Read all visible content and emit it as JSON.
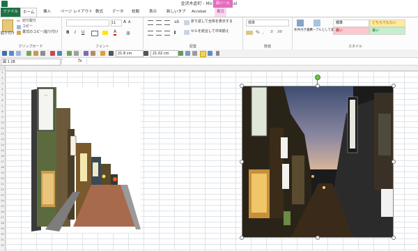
{
  "window": {
    "title": "金沢木倉町 - Microsoft Excel",
    "contextual_tab_group": "図ツール"
  },
  "tabs": [
    {
      "label": "ファイル"
    },
    {
      "label": "ホーム"
    },
    {
      "label": "挿入"
    },
    {
      "label": "ページ レイアウト"
    },
    {
      "label": "数式"
    },
    {
      "label": "データ"
    },
    {
      "label": "校閲"
    },
    {
      "label": "表示"
    },
    {
      "label": "新しいタブ"
    },
    {
      "label": "Acrobat"
    },
    {
      "label": "書式"
    }
  ],
  "ribbon": {
    "clipboard": {
      "paste": "貼り付け",
      "cut": "切り取り",
      "copy": "コピー",
      "format_painter": "書式のコピー/貼り付け",
      "label": "クリップボード"
    },
    "font": {
      "size": "11",
      "label": "フォント"
    },
    "alignment": {
      "wrap_text": "折り返して全体を表示する",
      "merge_center": "セルを結合して中央揃え",
      "label": "配置"
    },
    "number": {
      "format": "標準",
      "label": "数値"
    },
    "styles": {
      "conditional": "条件付き書式",
      "table": "テーブルとして書式設定",
      "cell_styles": [
        "標準",
        "どちらでもない",
        "悪い",
        "良い"
      ],
      "label": "スタイル"
    }
  },
  "qat": {
    "height": "21.8 cm",
    "width": "21.02 cm"
  },
  "formula_bar": {
    "name_box": "図 1 28",
    "fx": "fx"
  },
  "sheet": {
    "row_numbers": [
      "1",
      "2",
      "3",
      "4",
      "5",
      "6",
      "7",
      "8",
      "9",
      "10",
      "11",
      "12",
      "13",
      "14",
      "15",
      "16",
      "17",
      "18",
      "19",
      "20",
      "21",
      "22",
      "23",
      "24",
      "25",
      "26",
      "27",
      "28",
      "29",
      "30",
      "31",
      "32"
    ]
  },
  "images": [
    {
      "name": "street illustration",
      "type": "illustration"
    },
    {
      "name": "street photo",
      "type": "photo",
      "selected": true
    }
  ],
  "colors": {
    "excel_green": "#1e7145",
    "contextual_pink": "#e36dbd"
  }
}
